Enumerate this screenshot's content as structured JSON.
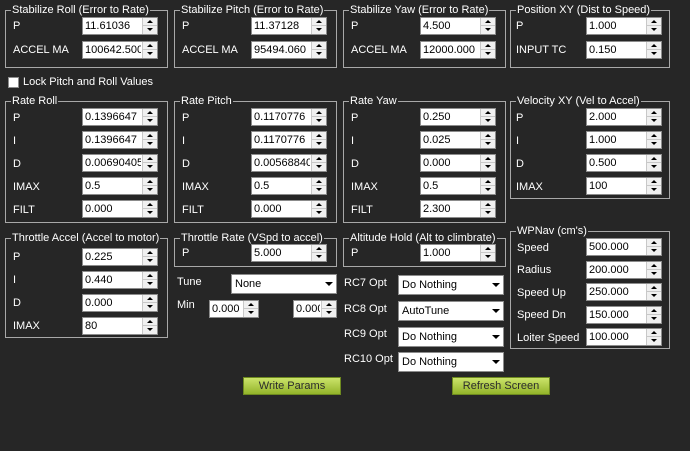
{
  "groups": {
    "stab_roll": {
      "title": "Stabilize Roll (Error to Rate)",
      "rows": [
        {
          "label": "P",
          "value": "11.61036"
        },
        {
          "label": "ACCEL MA",
          "value": "100642.500"
        }
      ]
    },
    "stab_pitch": {
      "title": "Stabilize Pitch (Error to Rate)",
      "rows": [
        {
          "label": "P",
          "value": "11.37128"
        },
        {
          "label": "ACCEL MA",
          "value": "95494.060"
        }
      ]
    },
    "stab_yaw": {
      "title": "Stabilize Yaw (Error to Rate)",
      "rows": [
        {
          "label": "P",
          "value": "4.500"
        },
        {
          "label": "ACCEL MA",
          "value": "12000.000"
        }
      ]
    },
    "pos_xy": {
      "title": "Position XY (Dist to Speed)",
      "rows": [
        {
          "label": "P",
          "value": "1.000"
        },
        {
          "label": "INPUT TC",
          "value": "0.150"
        }
      ]
    },
    "rate_roll": {
      "title": "Rate Roll",
      "rows": [
        {
          "label": "P",
          "value": "0.1396647"
        },
        {
          "label": "I",
          "value": "0.1396647"
        },
        {
          "label": "D",
          "value": "0.00690405"
        },
        {
          "label": "IMAX",
          "value": "0.5"
        },
        {
          "label": "FILT",
          "value": "0.000"
        }
      ]
    },
    "rate_pitch": {
      "title": "Rate Pitch",
      "rows": [
        {
          "label": "P",
          "value": "0.1170776"
        },
        {
          "label": "I",
          "value": "0.1170776"
        },
        {
          "label": "D",
          "value": "0.00568840"
        },
        {
          "label": "IMAX",
          "value": "0.5"
        },
        {
          "label": "FILT",
          "value": "0.000"
        }
      ]
    },
    "rate_yaw": {
      "title": "Rate Yaw",
      "rows": [
        {
          "label": "P",
          "value": "0.250"
        },
        {
          "label": "I",
          "value": "0.025"
        },
        {
          "label": "D",
          "value": "0.000"
        },
        {
          "label": "IMAX",
          "value": "0.5"
        },
        {
          "label": "FILT",
          "value": "2.300"
        }
      ]
    },
    "vel_xy": {
      "title": "Velocity XY (Vel to Accel)",
      "rows": [
        {
          "label": "P",
          "value": "2.000"
        },
        {
          "label": "I",
          "value": "1.000"
        },
        {
          "label": "D",
          "value": "0.500"
        },
        {
          "label": "IMAX",
          "value": "100"
        }
      ]
    },
    "throttle_accel": {
      "title": "Throttle Accel (Accel to motor)",
      "rows": [
        {
          "label": "P",
          "value": "0.225"
        },
        {
          "label": "I",
          "value": "0.440"
        },
        {
          "label": "D",
          "value": "0.000"
        },
        {
          "label": "IMAX",
          "value": "80"
        }
      ]
    },
    "throttle_rate": {
      "title": "Throttle Rate (VSpd to accel)",
      "rows": [
        {
          "label": "P",
          "value": "5.000"
        }
      ]
    },
    "alt_hold": {
      "title": "Altitude Hold (Alt to climbrate)",
      "rows": [
        {
          "label": "P",
          "value": "1.000"
        }
      ]
    },
    "wpnav": {
      "title": "WPNav (cm's)",
      "rows": [
        {
          "label": "Speed",
          "value": "500.000"
        },
        {
          "label": "Radius",
          "value": "200.000"
        },
        {
          "label": "Speed Up",
          "value": "250.000"
        },
        {
          "label": "Speed Dn",
          "value": "150.000"
        },
        {
          "label": "Loiter Speed",
          "value": "100.000"
        }
      ]
    }
  },
  "lock_pitch_roll": {
    "label": "Lock Pitch and Roll Values",
    "checked": false
  },
  "tune": {
    "label": "Tune",
    "value": "None",
    "min_label": "Min",
    "min_value": "0.000",
    "max_value": "0.000"
  },
  "rc_opts": [
    {
      "label": "RC7 Opt",
      "value": "Do Nothing"
    },
    {
      "label": "RC8 Opt",
      "value": "AutoTune"
    },
    {
      "label": "RC9 Opt",
      "value": "Do Nothing"
    },
    {
      "label": "RC10 Opt",
      "value": "Do Nothing"
    }
  ],
  "buttons": {
    "write": "Write Params",
    "refresh": "Refresh Screen"
  },
  "colors": {
    "background": "#262626",
    "button": "#a8c840",
    "border": "#a8a8a8"
  }
}
